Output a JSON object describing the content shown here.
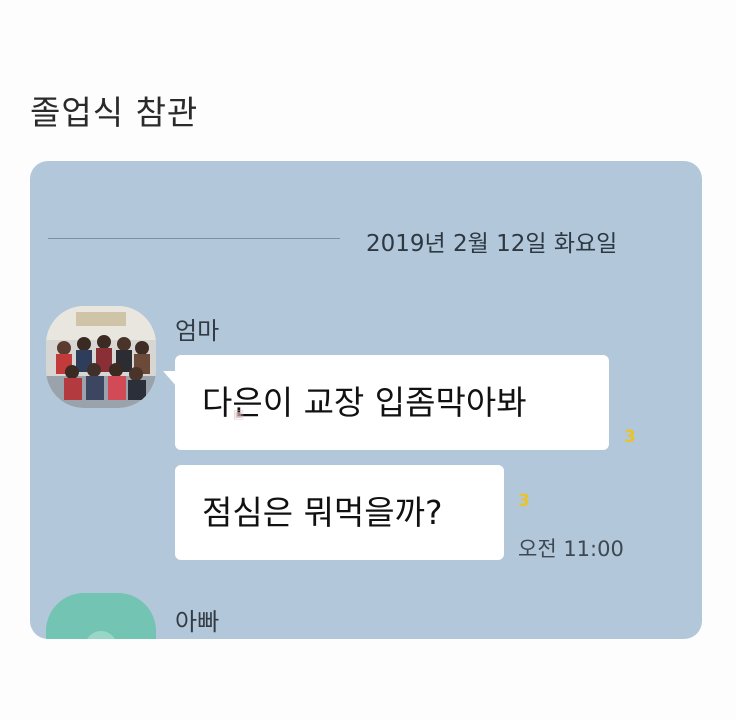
{
  "post": {
    "title": "졸업식 참관"
  },
  "chat": {
    "date_divider": "2019년 2월 12일 화요일",
    "messages": [
      {
        "sender": "엄마",
        "bubbles": [
          {
            "text": "다은이 교장 입좀막아봐",
            "unread": "3"
          },
          {
            "text": "점심은 뭐먹을까?",
            "unread": "3",
            "time": "오전 11:00"
          }
        ]
      },
      {
        "sender": "아빠"
      }
    ]
  },
  "colors": {
    "chat_background": "#b2c7d9",
    "bubble": "#ffffff",
    "unread_badge": "#e8c32c",
    "dad_avatar": "#73c4b2"
  }
}
